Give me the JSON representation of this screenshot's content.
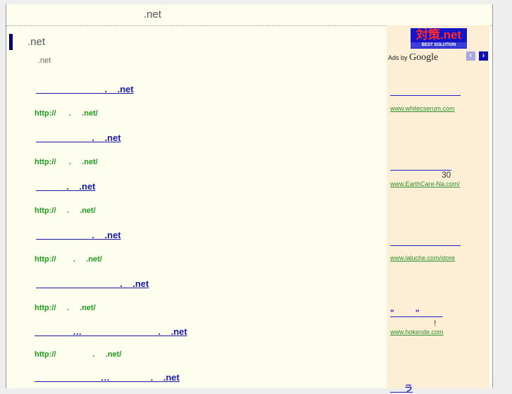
{
  "header": {
    "title": ".net"
  },
  "main": {
    "title": ".net",
    "subtitle": ".net",
    "results": [
      {
        "link": "                           .    .net",
        "url": "http://      .     .net/"
      },
      {
        "link": "                      .    .net",
        "url": "http://      .     .net/"
      },
      {
        "link": "            .    .net",
        "url": "http://     .     .net/"
      },
      {
        "link": "                      .    .net",
        "url": "http://        .     .net/"
      },
      {
        "link": "                                 .    .net",
        "url": "http://     .     .net/"
      },
      {
        "link": "               …                              .    .net",
        "url": "http://                 .     .net/"
      },
      {
        "link": "                          …                .    .net"
      }
    ]
  },
  "sidebar": {
    "logo": "対策.net",
    "logo_tagline": "BEST SOLUTION",
    "ads_by": "Ads by",
    "google": "Google",
    "prev": "‹",
    "next": "›",
    "ads": [
      {
        "title": "                              ",
        "url": "www.whitecserum.com"
      },
      {
        "title": "                          ",
        "extra": "30",
        "url": "www.EarthCare-Na.com/"
      },
      {
        "title": "                              ",
        "url": "www.laluche.com/store"
      },
      {
        "title": "\"         \"          ",
        "extra": "!",
        "url": "www.hokende.com"
      },
      {
        "title": "      ラ"
      }
    ]
  }
}
